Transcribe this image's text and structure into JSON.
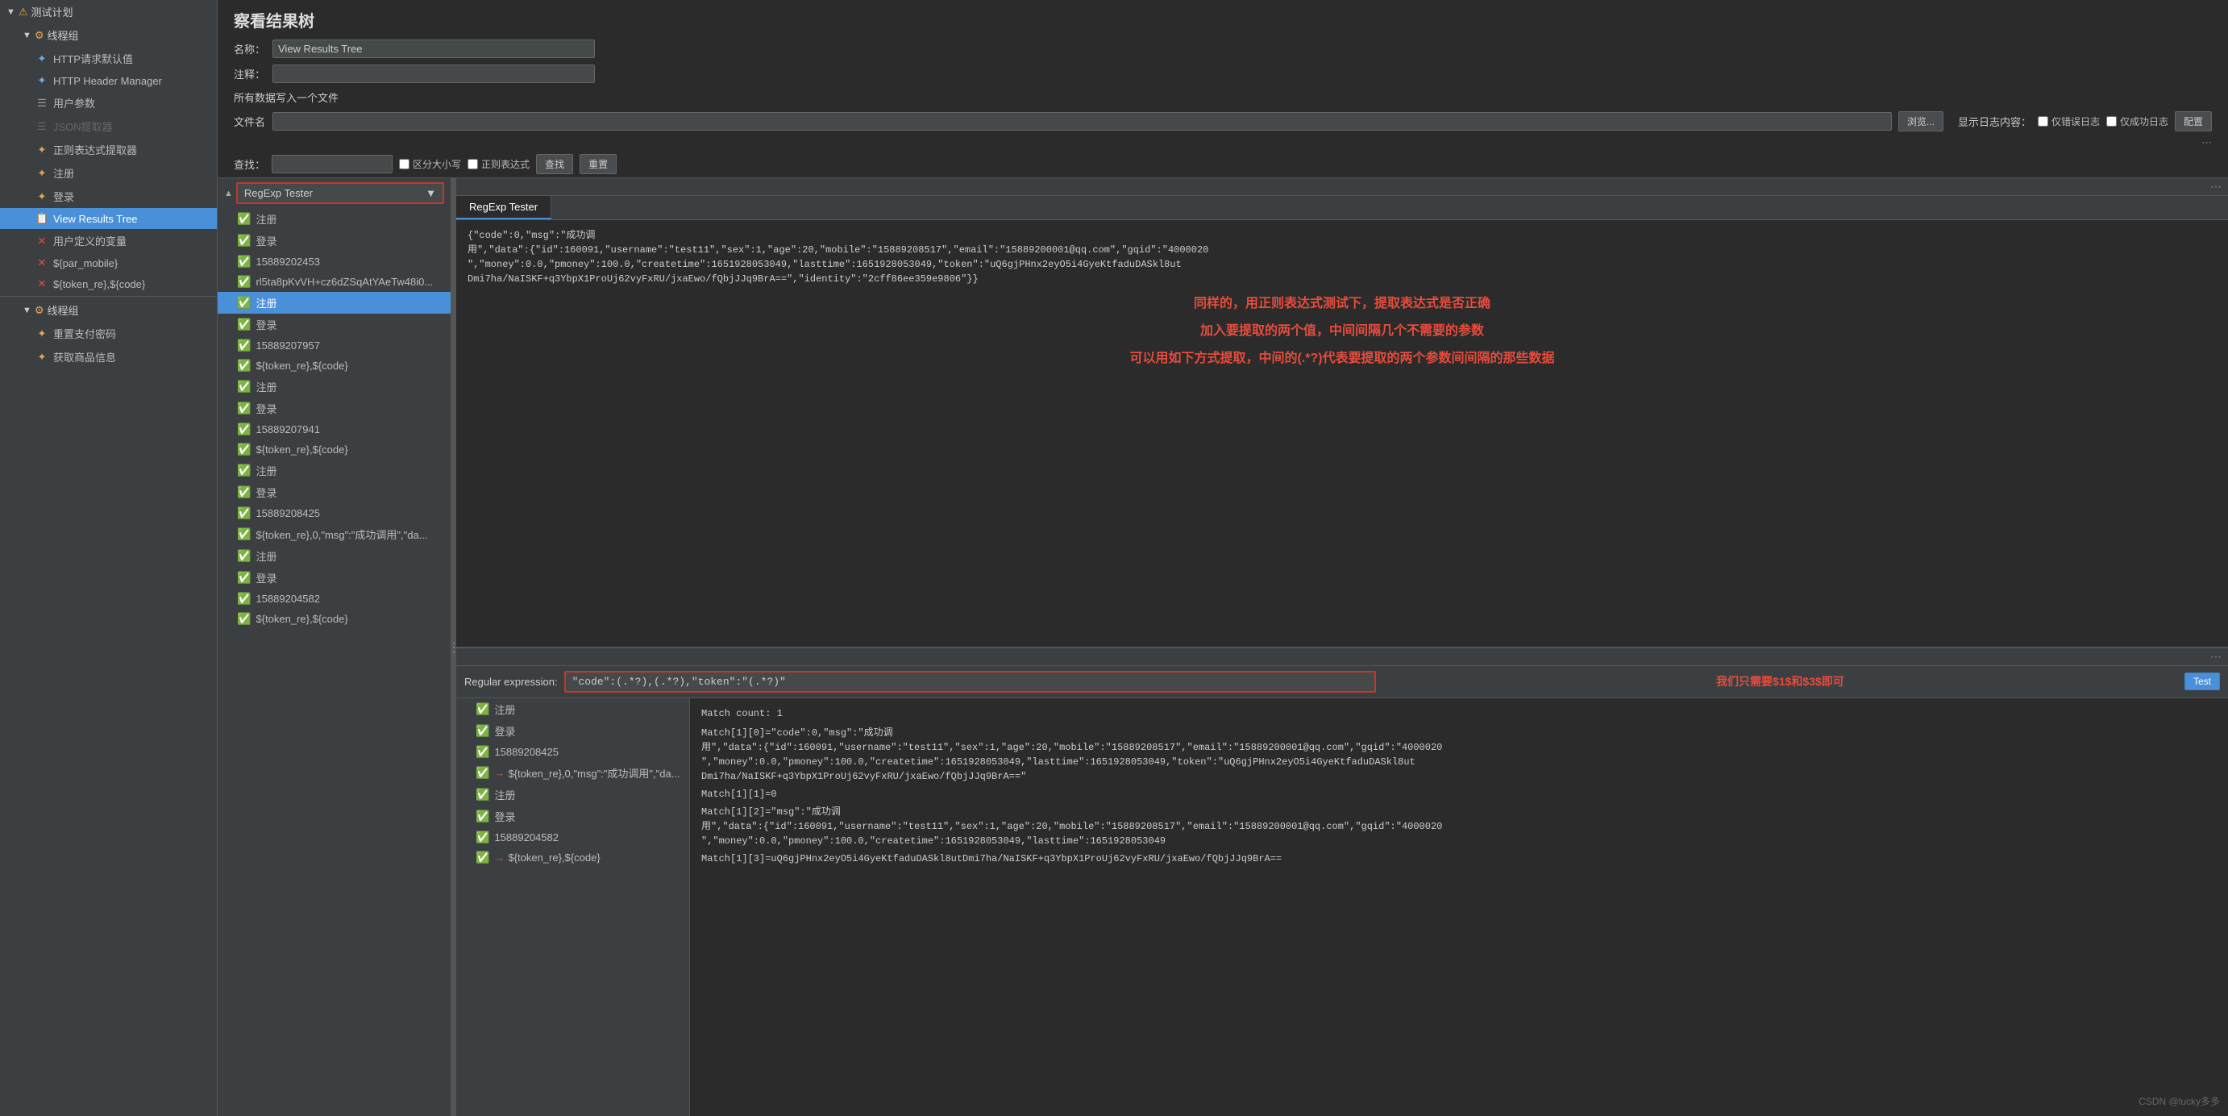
{
  "sidebar": {
    "title": "测试计划",
    "groups": [
      {
        "label": "线程组",
        "expanded": true,
        "items": [
          {
            "label": "HTTP请求默认值",
            "type": "http-defaults",
            "indent": 2
          },
          {
            "label": "HTTP Header Manager",
            "type": "http-header",
            "indent": 2
          },
          {
            "label": "用户参数",
            "type": "user-params",
            "indent": 2
          },
          {
            "label": "JSON提取器",
            "type": "json-extractor",
            "indent": 2,
            "disabled": true
          },
          {
            "label": "正则表达式提取器",
            "type": "regex-extractor",
            "indent": 2
          },
          {
            "label": "注册",
            "type": "request",
            "indent": 2
          },
          {
            "label": "登录",
            "type": "request",
            "indent": 2
          },
          {
            "label": "View Results Tree",
            "type": "results-tree",
            "indent": 2,
            "active": true
          },
          {
            "label": "用户定义的变量",
            "type": "user-vars",
            "indent": 2
          },
          {
            "label": "${par_mobile}",
            "type": "var",
            "indent": 2
          },
          {
            "label": "${token_re},${code}",
            "type": "var",
            "indent": 2
          }
        ]
      },
      {
        "label": "线程组",
        "expanded": true,
        "items": [
          {
            "label": "重置支付密码",
            "type": "request",
            "indent": 2
          },
          {
            "label": "获取商品信息",
            "type": "request",
            "indent": 2
          }
        ]
      }
    ]
  },
  "panel": {
    "title": "察看结果树",
    "name_label": "名称：",
    "name_value": "View Results Tree",
    "comment_label": "注释：",
    "comment_value": "",
    "file_section_label": "所有数据写入一个文件",
    "file_label": "文件名",
    "file_value": "",
    "browse_btn": "浏览...",
    "log_content_label": "显示日志内容：",
    "errors_only_label": "仅错误日志",
    "success_only_label": "仅成功日志",
    "configure_btn": "配置",
    "search_label": "查找：",
    "search_value": "",
    "case_sensitive_label": "区分大小写",
    "regex_search_label": "正则表达式",
    "find_btn": "查找",
    "reset_btn": "重置"
  },
  "tree": {
    "dropdown_label": "RegExp Tester",
    "items": [
      {
        "label": "注册",
        "status": "success",
        "indent": 1
      },
      {
        "label": "登录",
        "status": "success",
        "indent": 1
      },
      {
        "label": "15889202453",
        "status": "success",
        "indent": 1
      },
      {
        "label": "rl5ta8pKvVH+cz6dZSqAtYAeTw48i0...",
        "status": "success",
        "indent": 1
      },
      {
        "label": "注册",
        "status": "success",
        "indent": 1,
        "selected": true
      },
      {
        "label": "登录",
        "status": "success",
        "indent": 1
      },
      {
        "label": "15889207957",
        "status": "success",
        "indent": 1
      },
      {
        "label": "${token_re},${code}",
        "status": "success",
        "indent": 1
      },
      {
        "label": "注册",
        "status": "success",
        "indent": 1
      },
      {
        "label": "登录",
        "status": "success",
        "indent": 1
      },
      {
        "label": "15889207941",
        "status": "success",
        "indent": 1
      },
      {
        "label": "${token_re},${code}",
        "status": "success",
        "indent": 1
      },
      {
        "label": "注册",
        "status": "success",
        "indent": 1
      },
      {
        "label": "登录",
        "status": "success",
        "indent": 1
      },
      {
        "label": "15889208425",
        "status": "success",
        "indent": 1
      },
      {
        "label": "${token_re},0,\"msg\":\"成功调用\",\"da...",
        "status": "success",
        "indent": 1
      },
      {
        "label": "注册",
        "status": "success",
        "indent": 1
      },
      {
        "label": "登录",
        "status": "success",
        "indent": 1
      },
      {
        "label": "15889204582",
        "status": "success",
        "indent": 1
      },
      {
        "label": "${token_re},${code}",
        "status": "success",
        "indent": 1
      }
    ]
  },
  "right_panel": {
    "tab_label": "RegExp Tester",
    "json_response": "{\"code\":0,\"msg\":\"成功调\n用\",\"data\":{\"id\":160091,\"username\":\"test11\",\"sex\":1,\"age\":20,\"mobile\":\"15889208517\",\"email\":\"15889200001@qq.com\",\"gqid\":\"4000020\n\",\"money\":0.0,\"pmoney\":100.0,\"createtime\":1651928053049,\"lasttime\":1651928053049,\"token\":\"uQ6gjPHnx2eyO5i4GyeKtfaduDASkl8ut\nDmi7ha/NaISKF+q3YbpX1ProUj62vyFxRU/jxaEwo/fQbjJJq9BrA==\",\"identity\":\"2cff86ee359e9806\"}}",
    "annotation1": "同样的，用正则表达式测试下，提取表达式是否正确",
    "annotation2": "加入要提取的两个值，中间间隔几个不需要的参数",
    "annotation3": "可以用如下方式提取，中间的(.*?)代表要提取的两个参数间间隔的那些数据",
    "dots": "...",
    "regex_label": "Regular expression:",
    "regex_value": "\"code\":(.*?),(.*?),\"token\":\"(.*?)\"",
    "annotation_inline": "我们只需要$1$和$3$即可",
    "test_btn": "Test",
    "match_result": "Match count: 1",
    "match_lines": [
      "Match[1][0]=\"code\":0,\"msg\":\"成功调\n用\",\"data\":{\"id\":160091,\"username\":\"test11\",\"sex\":1,\"age\":20,\"mobile\":\"15889208517\",\"email\":\"15889200001@qq.com\",\"gqid\":\"4000020\n\",\"money\":0.0,\"pmoney\":100.0,\"createtime\":1651928053049,\"lasttime\":1651928053049,\"token\":\"uQ6gjPHnx2eyO5i4GyeKtfaduDASkl8ut\nDmi7ha/NaISKF+q3YbpX1ProUj62vyFxRU/jxaEwo/fQbjJJq9BrA==\"",
      "Match[1][1]=0",
      "Match[1][2]=\"msg\":\"成功调\n用\",\"data\":{\"id\":160091,\"username\":\"test11\",\"sex\":1,\"age\":20,\"mobile\":\"15889208517\",\"email\":\"15889200001@qq.com\",\"gqid\":\"4000020\n\",\"money\":0.0,\"pmoney\":100.0,\"createtime\":1651928053049,\"lasttime\":1651928053049",
      "Match[1][3]=uQ6gjPHnx2eyO5i4GyeKtfaduDASkl8utDmi7ha/NaISKF+q3YbpX1ProUj62vyFxRU/jxaEwo/fQbjJJq9BrA=="
    ]
  },
  "watermark": "CSDN @lucky多多"
}
